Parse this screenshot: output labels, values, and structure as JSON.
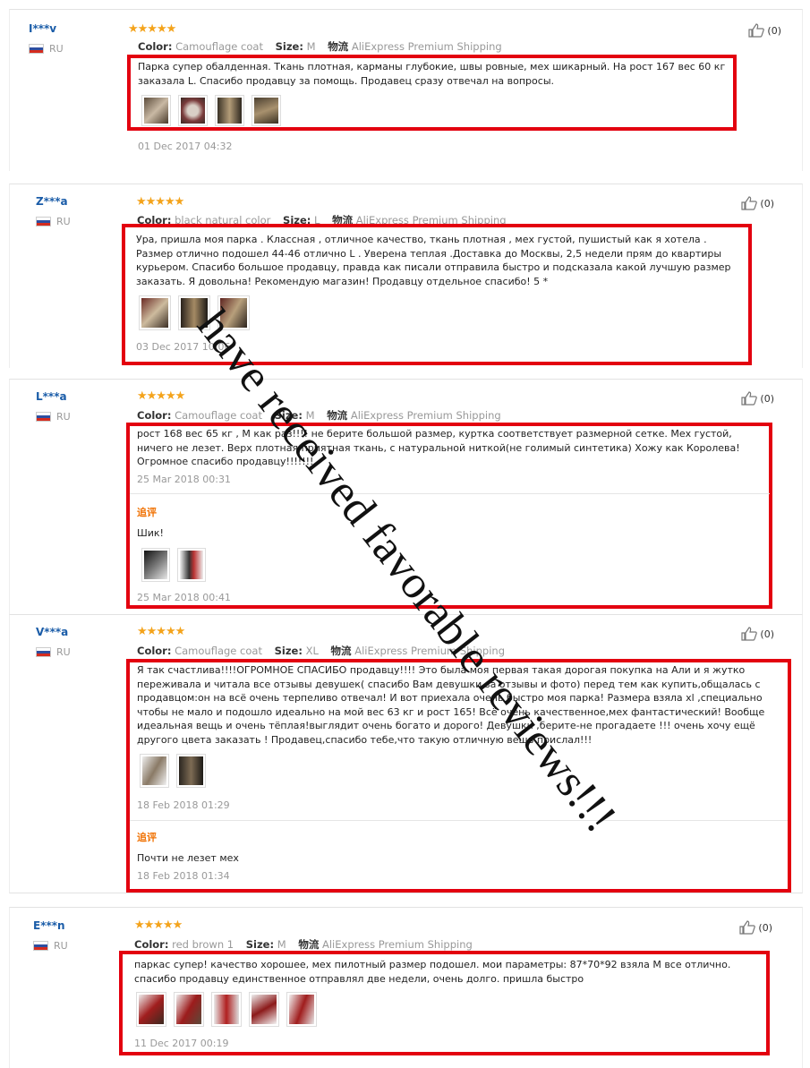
{
  "colors": {
    "frame": "#e3000f",
    "username": "#1a5ca8",
    "stars": "#f4a31b",
    "additional": "#f07000"
  },
  "labels": {
    "color": "Color:",
    "size": "Size:",
    "ship_label": "物流",
    "shipping": "AliExpress Premium Shipping",
    "stars": "★★★★★",
    "helpful": "(0)"
  },
  "overlay_text": "have received favorable reviews!!!",
  "reviews": [
    {
      "user": "I***v",
      "country": "RU",
      "color": "Camouflage coat",
      "size": "M",
      "text": "Парка супер обалденная. Ткань плотная, карманы глубокие, швы ровные, мех шикарный. На рост 167 вес 60 кг заказала L. Спасибо продавцу за помощь. Продавец сразу отвечал на вопросы.",
      "date": "01 Dec 2017 04:32"
    },
    {
      "user": "Z***a",
      "country": "RU",
      "color": "black natural color",
      "size": "L",
      "text": "Ура, пришла моя парка . Классная , отличное качество, ткань плотная , мех густой, пушистый как я хотела . Размер отлично подошел 44-46 отлично L . Уверена теплая .Доставка до Москвы, 2,5 недели прям до квартиры курьером. Спасибо большое продавцу, правда как писали отправила быстро и подсказала какой лучшую размер заказать. Я довольна! Рекомендую магазин! Продавцу отдельное спасибо! 5 *",
      "date": "03 Dec 2017 10:06"
    },
    {
      "user": "L***a",
      "country": "RU",
      "color": "Camouflage coat",
      "size": "M",
      "text": "рост 168 вес 65 кг , М как раз!!!! не берите большой размер, куртка соответствует размерной сетке. Мех густой, ничего не лезет. Верх плотная приятная ткань, с натуральной ниткой(не голимый синтетика) Хожу как Королева! Огромное спасибо продавцу!!!!!!!",
      "date": "25 Mar 2018 00:31",
      "additional_label": "追评",
      "additional_text": "Шик!",
      "additional_date": "25 Mar 2018 00:41"
    },
    {
      "user": "V***a",
      "country": "RU",
      "color": "Camouflage coat",
      "size": "XL",
      "text": "Я так счастлива!!!!ОГРОМНОЕ СПАСИБО продавцу!!!! Это была моя первая такая дорогая покупка на Али и я жутко переживала и читала все отзывы девушек( спасибо Вам девушки за отзывы и фото) перед тем как купить,общалась с продавцом:он на всё очень терпеливо отвечал! И вот приехала очень быстро моя парка! Размера взяла xl ,специально чтобы не мало и подошло идеально на мой вес 63 кг и рост 165! Всё очень качественное,мех фантастический! Вообще идеальная вещь и очень тёплая!выглядит очень богато и дорого! Девушки ,берите-не прогадаете !!! очень хочу ещё другого цвета заказать ! Продавец,спасибо тебе,что такую отличную вещь прислал!!!",
      "date": "18 Feb 2018 01:29",
      "additional_label": "追评",
      "additional_text": "Почти не лезет мех",
      "additional_date": "18 Feb 2018 01:34"
    },
    {
      "user": "E***n",
      "country": "RU",
      "color": "red brown 1",
      "size": "M",
      "text": "паркас супер! качество хорошее, мех пилотный размер подошел. мои параметры: 87*70*92 взяла М все отлично. спасибо продавцу единственное отправлял две недели, очень долго. пришла быстро",
      "date": "11 Dec 2017 00:19"
    }
  ]
}
